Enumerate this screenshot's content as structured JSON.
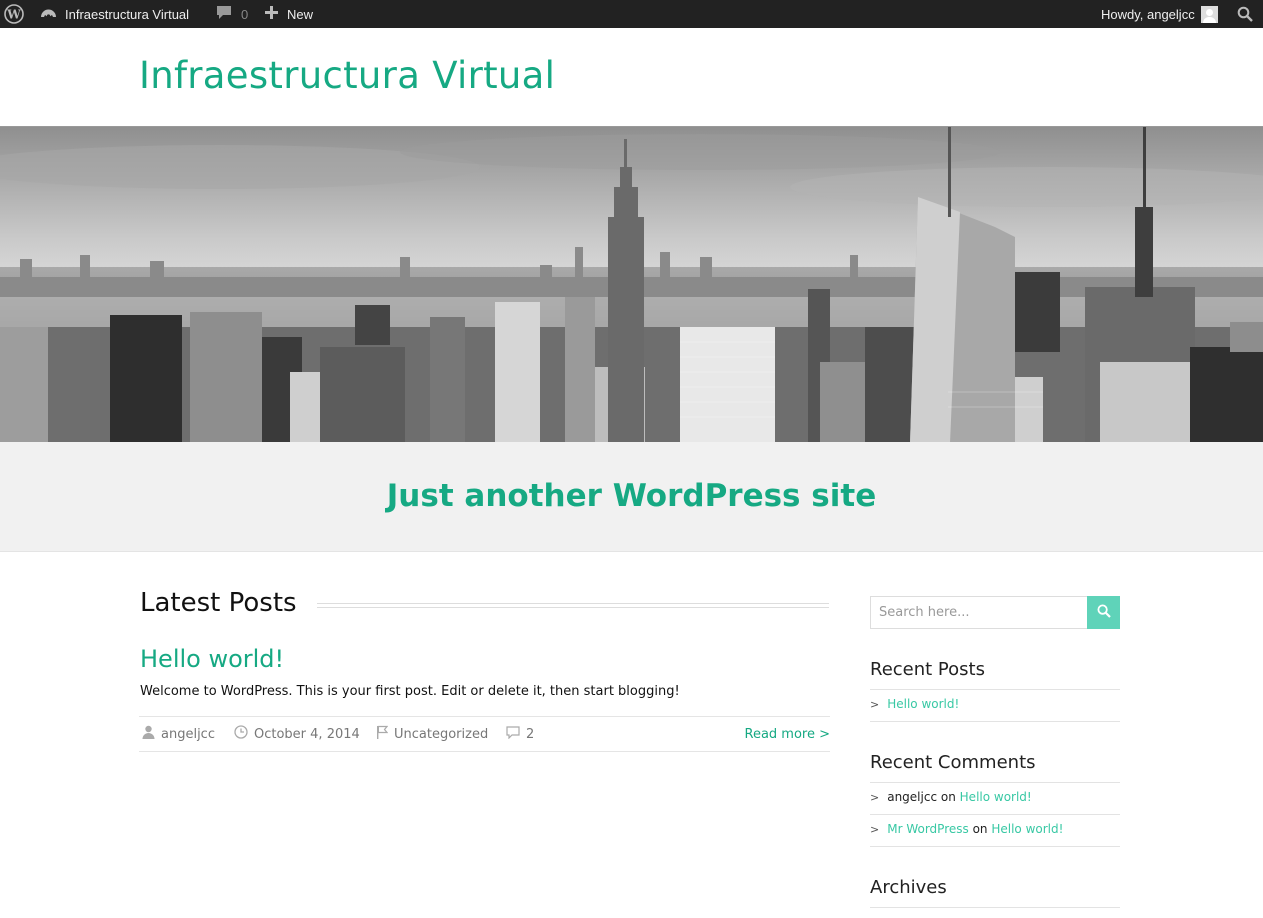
{
  "adminbar": {
    "site_name": "Infraestructura Virtual",
    "comments_count": "0",
    "new_label": "New",
    "howdy": "Howdy, angeljcc"
  },
  "header": {
    "site_title": "Infraestructura Virtual",
    "tagline": "Just another WordPress site"
  },
  "main": {
    "section_heading": "Latest Posts",
    "post": {
      "title": "Hello world!",
      "excerpt": "Welcome to WordPress. This is your first post. Edit or delete it, then start blogging!",
      "author": "angeljcc",
      "date": "October 4, 2014",
      "category": "Uncategorized",
      "comments": "2",
      "read_more": "Read more >"
    }
  },
  "sidebar": {
    "search_placeholder": "Search here...",
    "recent_posts": {
      "title": "Recent Posts",
      "items": [
        "Hello world!"
      ]
    },
    "recent_comments": {
      "title": "Recent Comments",
      "items": [
        {
          "author": "angeljcc",
          "on": "on",
          "post": "Hello world!"
        },
        {
          "author": "Mr WordPress",
          "on": "on",
          "post": "Hello world!"
        }
      ]
    },
    "archives": {
      "title": "Archives"
    }
  },
  "colors": {
    "accent": "#16a983",
    "link": "#38c8a4",
    "adminbar": "#222222",
    "search_button": "#5fd3b9"
  },
  "icons": [
    "wordpress-logo-icon",
    "dashboard-icon",
    "comment-bubble-icon",
    "plus-icon",
    "search-icon",
    "user-icon",
    "clock-icon",
    "flag-icon",
    "comment-icon"
  ]
}
